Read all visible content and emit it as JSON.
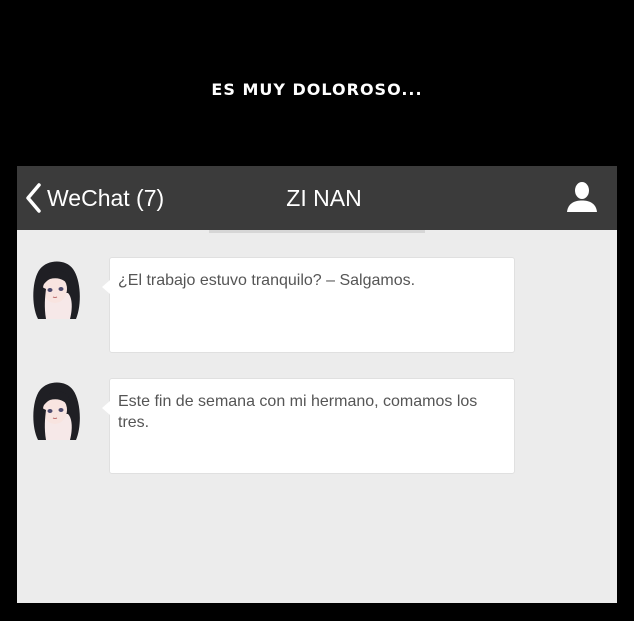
{
  "caption": "ES MUY DOLOROSO...",
  "chat": {
    "back_label": "WeChat (7)",
    "title": "ZI NAN",
    "back_icon": "chevron-left-icon",
    "profile_icon": "user-icon"
  },
  "messages": [
    {
      "text": "¿El trabajo estuvo tranquilo? – Salgamos."
    },
    {
      "text": "Este fin de semana con mi hermano, comamos los tres."
    }
  ],
  "colors": {
    "background": "#000000",
    "topbar": "#3b3b3b",
    "chat_background": "#ececec",
    "bubble": "#ffffff",
    "message_text": "#555555"
  }
}
